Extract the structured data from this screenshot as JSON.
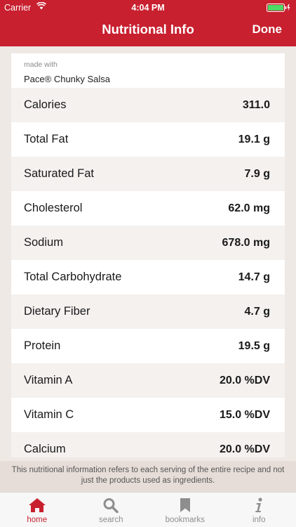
{
  "status": {
    "carrier": "Carrier",
    "time": "4:04 PM"
  },
  "nav": {
    "title": "Nutritional Info",
    "done": "Done"
  },
  "made_with": {
    "label": "made with",
    "product": "Pace® Chunky Salsa"
  },
  "nutrients": [
    {
      "name": "Calories",
      "value": "311.0"
    },
    {
      "name": "Total Fat",
      "value": "19.1 g"
    },
    {
      "name": "Saturated Fat",
      "value": "7.9 g"
    },
    {
      "name": "Cholesterol",
      "value": "62.0 mg"
    },
    {
      "name": "Sodium",
      "value": "678.0 mg"
    },
    {
      "name": "Total Carbohydrate",
      "value": "14.7 g"
    },
    {
      "name": "Dietary Fiber",
      "value": "4.7 g"
    },
    {
      "name": "Protein",
      "value": "19.5 g"
    },
    {
      "name": "Vitamin A",
      "value": "20.0 %DV"
    },
    {
      "name": "Vitamin C",
      "value": "15.0 %DV"
    },
    {
      "name": "Calcium",
      "value": "20.0 %DV"
    }
  ],
  "disclaimer": "This nutritional information refers to each serving of the entire recipe and not just the products used as ingredients.",
  "tabs": [
    {
      "label": "home",
      "icon": "home-icon",
      "active": true
    },
    {
      "label": "search",
      "icon": "search-icon",
      "active": false
    },
    {
      "label": "bookmarks",
      "icon": "bookmark-icon",
      "active": false
    },
    {
      "label": "info",
      "icon": "info-icon",
      "active": false
    }
  ],
  "colors": {
    "brand": "#c8202f",
    "background": "#efe9e5",
    "row_alt": "#ffffff",
    "row": "#f4f1ef",
    "tab_inactive": "#8e8e8e"
  }
}
